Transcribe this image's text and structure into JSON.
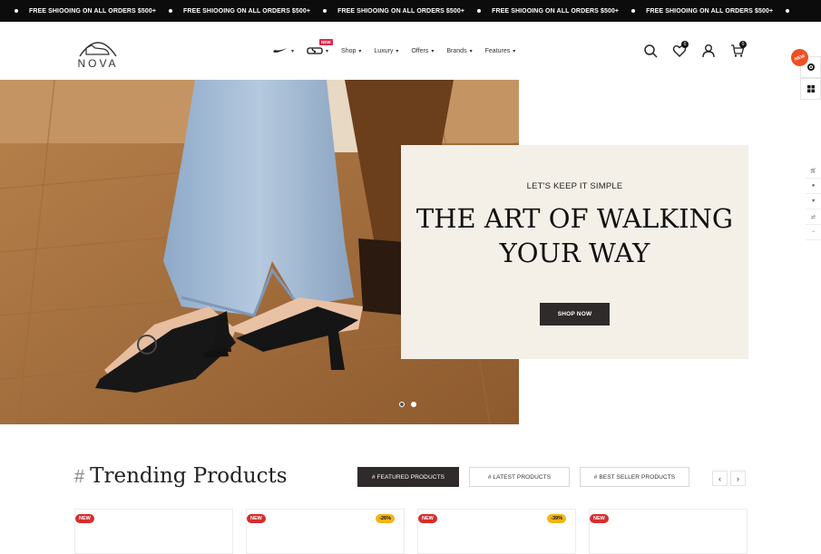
{
  "announcement": {
    "messages": [
      "FREE SHIOOING ON ALL ORDERS $500+",
      "FREE SHIOOING ON ALL ORDERS $500+",
      "FREE SHIOOING ON ALL ORDERS $500+",
      "FREE SHIOOING ON ALL ORDERS $500+",
      "FREE SHIOOING ON ALL ORDERS $500+"
    ]
  },
  "header": {
    "logo_text": "NOVA",
    "nav": {
      "brand_new_tag": "NEW",
      "items": [
        "Shop",
        "Luxury",
        "Offers",
        "Brands",
        "Features"
      ]
    },
    "wishlist_count": "0",
    "cart_count": "0"
  },
  "side": {
    "new_badge": "NEW",
    "social_icons": [
      "facebook-icon",
      "twitter-icon",
      "youtube-icon",
      "pinterest-icon",
      "instagram-icon"
    ]
  },
  "hero": {
    "eyebrow": "LET'S KEEP IT SIMPLE",
    "headline_line1": "THE ART OF WALKING",
    "headline_line2": "YOUR WAY",
    "cta": "SHOP NOW",
    "slide_count": 2,
    "active_slide": 1
  },
  "trending": {
    "hash": "#",
    "title": "Trending Products",
    "tabs": [
      "# FEATURED PRODUCTS",
      "# LATEST PRODUCTS",
      "# BEST SELLER PRODUCTS"
    ],
    "prev": "‹",
    "next": "›",
    "cards": [
      {
        "badge": "NEW",
        "discount": ""
      },
      {
        "badge": "NEW",
        "discount": "-26%"
      },
      {
        "badge": "NEW",
        "discount": "-39%"
      },
      {
        "badge": "NEW",
        "discount": ""
      }
    ]
  },
  "colors": {
    "accent_dark": "#2f2b2a",
    "new_red": "#d62d2d",
    "discount_yellow": "#f2b417",
    "promo_bg": "#f4f0e8"
  }
}
